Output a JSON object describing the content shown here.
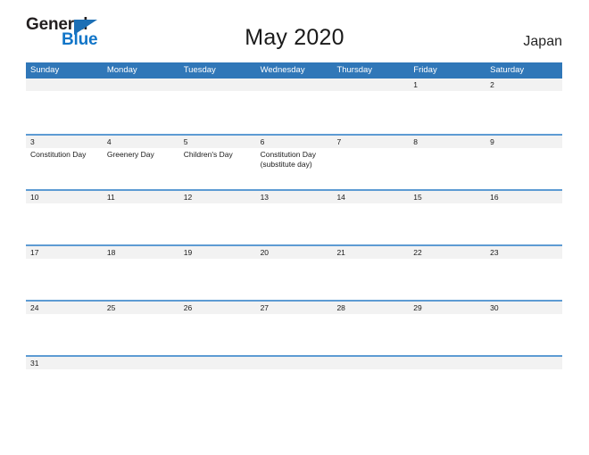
{
  "brand": {
    "name_part1": "General",
    "name_part2": "Blue",
    "color_dark": "#231f20",
    "color_blue": "#1175c8",
    "triangle_color": "#1c6fb5"
  },
  "header": {
    "title": "May 2020",
    "locale": "Japan"
  },
  "theme": {
    "header_blue": "#3077b8",
    "row_rule_blue": "#5d9bd3",
    "date_band_gray": "#f2f2f2",
    "text_dark": "#1a1a1a"
  },
  "weekdays": [
    {
      "label": "Sunday"
    },
    {
      "label": "Monday"
    },
    {
      "label": "Tuesday"
    },
    {
      "label": "Wednesday"
    },
    {
      "label": "Thursday"
    },
    {
      "label": "Friday"
    },
    {
      "label": "Saturday"
    }
  ],
  "weeks": [
    {
      "days": [
        {
          "date": "",
          "event": ""
        },
        {
          "date": "",
          "event": ""
        },
        {
          "date": "",
          "event": ""
        },
        {
          "date": "",
          "event": ""
        },
        {
          "date": "",
          "event": ""
        },
        {
          "date": "1",
          "event": ""
        },
        {
          "date": "2",
          "event": ""
        }
      ]
    },
    {
      "days": [
        {
          "date": "3",
          "event": "Constitution Day"
        },
        {
          "date": "4",
          "event": "Greenery Day"
        },
        {
          "date": "5",
          "event": "Children's Day"
        },
        {
          "date": "6",
          "event": "Constitution Day\n(substitute day)"
        },
        {
          "date": "7",
          "event": ""
        },
        {
          "date": "8",
          "event": ""
        },
        {
          "date": "9",
          "event": ""
        }
      ]
    },
    {
      "days": [
        {
          "date": "10",
          "event": ""
        },
        {
          "date": "11",
          "event": ""
        },
        {
          "date": "12",
          "event": ""
        },
        {
          "date": "13",
          "event": ""
        },
        {
          "date": "14",
          "event": ""
        },
        {
          "date": "15",
          "event": ""
        },
        {
          "date": "16",
          "event": ""
        }
      ]
    },
    {
      "days": [
        {
          "date": "17",
          "event": ""
        },
        {
          "date": "18",
          "event": ""
        },
        {
          "date": "19",
          "event": ""
        },
        {
          "date": "20",
          "event": ""
        },
        {
          "date": "21",
          "event": ""
        },
        {
          "date": "22",
          "event": ""
        },
        {
          "date": "23",
          "event": ""
        }
      ]
    },
    {
      "days": [
        {
          "date": "24",
          "event": ""
        },
        {
          "date": "25",
          "event": ""
        },
        {
          "date": "26",
          "event": ""
        },
        {
          "date": "27",
          "event": ""
        },
        {
          "date": "28",
          "event": ""
        },
        {
          "date": "29",
          "event": ""
        },
        {
          "date": "30",
          "event": ""
        }
      ]
    },
    {
      "days": [
        {
          "date": "31",
          "event": ""
        },
        {
          "date": "",
          "event": ""
        },
        {
          "date": "",
          "event": ""
        },
        {
          "date": "",
          "event": ""
        },
        {
          "date": "",
          "event": ""
        },
        {
          "date": "",
          "event": ""
        },
        {
          "date": "",
          "event": ""
        }
      ]
    }
  ]
}
